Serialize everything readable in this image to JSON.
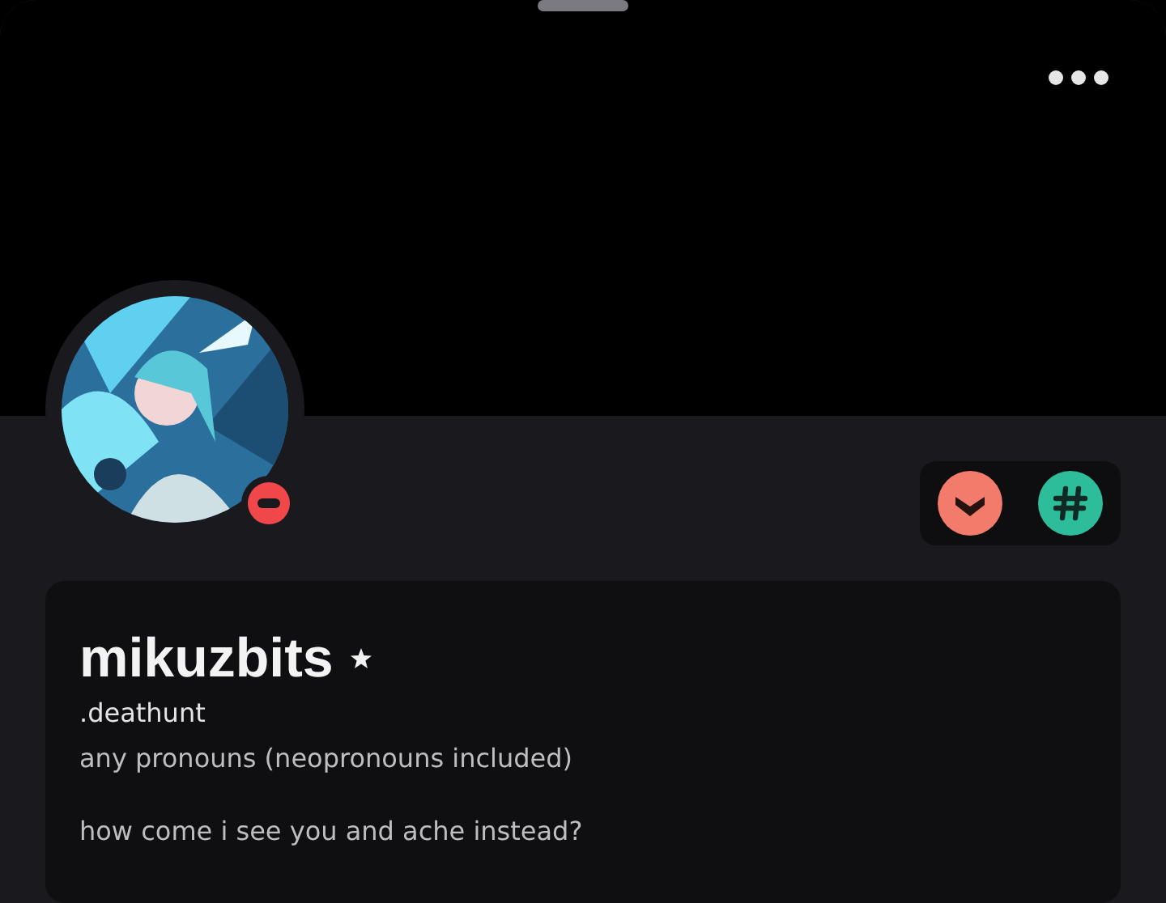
{
  "profile": {
    "do_not_disturb": true,
    "display_name": "mikuzbits",
    "username": ".deathunt",
    "pronouns": "any pronouns (neopronouns included)",
    "bio": "how come i see you and ache instead?"
  },
  "badges": [
    {
      "kind": "chevron",
      "color": "#f27b6b"
    },
    {
      "kind": "hash",
      "color": "#2ebd9b"
    }
  ]
}
